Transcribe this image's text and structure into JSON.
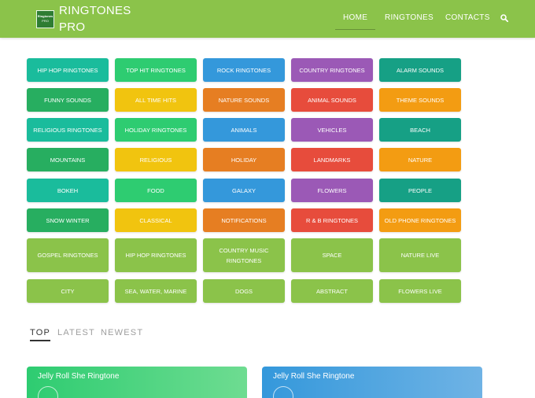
{
  "header": {
    "logo_text": "Ringtones",
    "logo_subtext": "PRO",
    "site_title": "RINGTONES PRO",
    "nav": {
      "home": "HOME",
      "ringtones": "RINGTONES",
      "contacts": "CONTACTS"
    },
    "background_color": "#8bc34a"
  },
  "categories": [
    {
      "label": "HIP HOP RINGTONES",
      "color": "#1abc9c"
    },
    {
      "label": "TOP HIT RINGTONES",
      "color": "#2ecc71"
    },
    {
      "label": "ROCK RINGTONES",
      "color": "#3498db"
    },
    {
      "label": "COUNTRY RINGTONES",
      "color": "#9b59b6"
    },
    {
      "label": "ALARM SOUNDS",
      "color": "#16a085"
    },
    {
      "label": "FUNNY SOUNDS",
      "color": "#27ae60"
    },
    {
      "label": "ALL TIME HITS",
      "color": "#f1c40f"
    },
    {
      "label": "NATURE SOUNDS",
      "color": "#e67e22"
    },
    {
      "label": "ANIMAL SOUNDS",
      "color": "#e74c3c"
    },
    {
      "label": "THEME SOUNDS",
      "color": "#f39c12"
    },
    {
      "label": "RELIGIOUS RINGTONES",
      "color": "#1abc9c"
    },
    {
      "label": "HOLIDAY RINGTONES",
      "color": "#2ecc71"
    },
    {
      "label": "ANIMALS",
      "color": "#3498db"
    },
    {
      "label": "VEHICLES",
      "color": "#9b59b6"
    },
    {
      "label": "BEACH",
      "color": "#16a085"
    },
    {
      "label": "MOUNTAINS",
      "color": "#27ae60"
    },
    {
      "label": "RELIGIOUS",
      "color": "#f1c40f"
    },
    {
      "label": "HOLIDAY",
      "color": "#e67e22"
    },
    {
      "label": "LANDMARKS",
      "color": "#e74c3c"
    },
    {
      "label": "NATURE",
      "color": "#f39c12"
    },
    {
      "label": "BOKEH",
      "color": "#1abc9c"
    },
    {
      "label": "FOOD",
      "color": "#2ecc71"
    },
    {
      "label": "GALAXY",
      "color": "#3498db"
    },
    {
      "label": "FLOWERS",
      "color": "#9b59b6"
    },
    {
      "label": "PEOPLE",
      "color": "#16a085"
    },
    {
      "label": "SNOW WINTER",
      "color": "#27ae60"
    },
    {
      "label": "CLASSICAL",
      "color": "#f1c40f"
    },
    {
      "label": "NOTIFICATIONS",
      "color": "#e67e22"
    },
    {
      "label": "R & B RINGTONES",
      "color": "#e74c3c"
    },
    {
      "label": "OLD PHONE RINGTONES",
      "color": "#f39c12"
    },
    {
      "label": "GOSPEL RINGTONES",
      "color": "#8bc34a"
    },
    {
      "label": "HIP HOP RINGTONES",
      "color": "#8bc34a"
    },
    {
      "label": "COUNTRY MUSIC RINGTONES",
      "color": "#8bc34a"
    },
    {
      "label": "SPACE",
      "color": "#8bc34a"
    },
    {
      "label": "NATURE LIVE",
      "color": "#8bc34a"
    },
    {
      "label": "CITY",
      "color": "#8bc34a"
    },
    {
      "label": "SEA, WATER, MARINE",
      "color": "#8bc34a"
    },
    {
      "label": "DOGS",
      "color": "#8bc34a"
    },
    {
      "label": "ABSTRACT",
      "color": "#8bc34a"
    },
    {
      "label": "FLOWERS LIVE",
      "color": "#8bc34a"
    }
  ],
  "tabs": {
    "top": "TOP",
    "latest": "LATEST",
    "newest": "NEWEST",
    "active": "top"
  },
  "cards": [
    {
      "title": "Jelly Roll She Ringtone",
      "color": "#2ecc71"
    },
    {
      "title": "Jelly Roll She Ringtone",
      "color": "#3498db"
    }
  ]
}
